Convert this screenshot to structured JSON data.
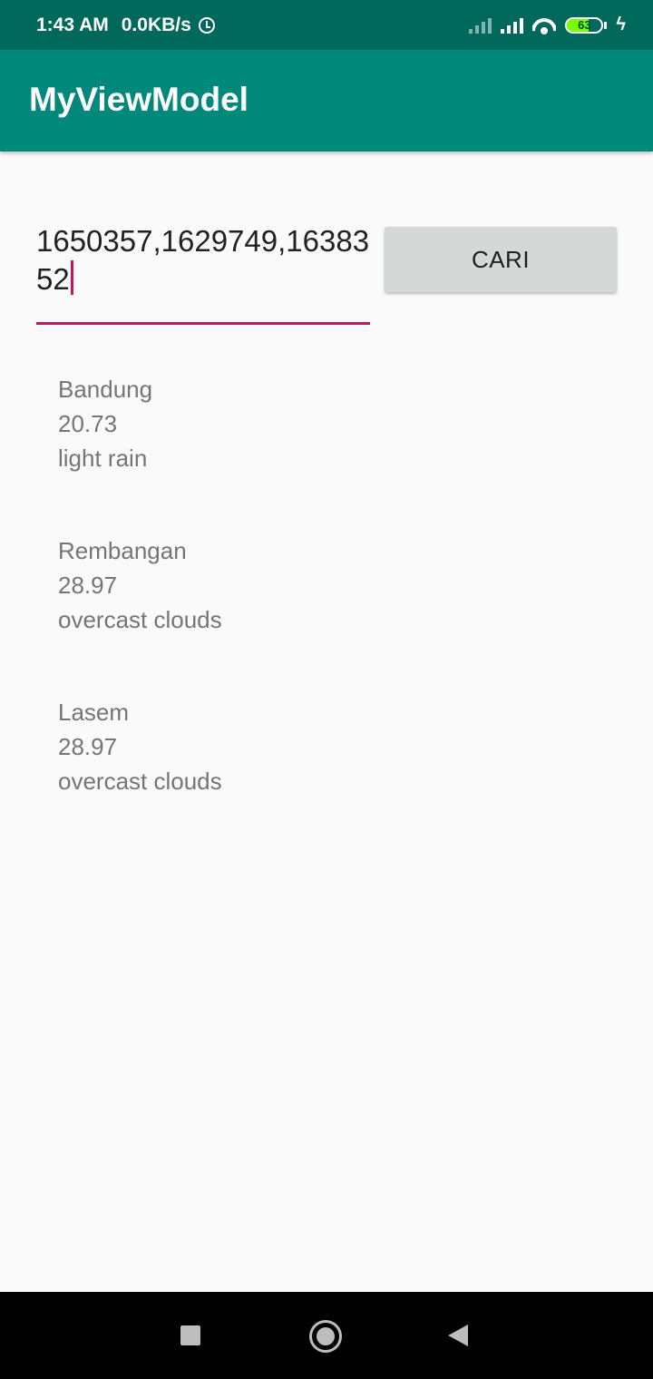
{
  "status_bar": {
    "time": "1:43 AM",
    "speed": "0.0KB/s",
    "battery": "63",
    "battery_level_percent": 63
  },
  "app_bar": {
    "title": "MyViewModel"
  },
  "search": {
    "value": "1650357,1629749,1638352",
    "button_label": "CARI"
  },
  "results": [
    {
      "city": "Bandung",
      "temp": "20.73",
      "description": "light rain"
    },
    {
      "city": "Rembangan",
      "temp": "28.97",
      "description": "overcast clouds"
    },
    {
      "city": "Lasem",
      "temp": "28.97",
      "description": "overcast clouds"
    }
  ],
  "colors": {
    "app_bar": "#00897b",
    "status_bar": "#00695c",
    "accent": "#c2185b"
  }
}
